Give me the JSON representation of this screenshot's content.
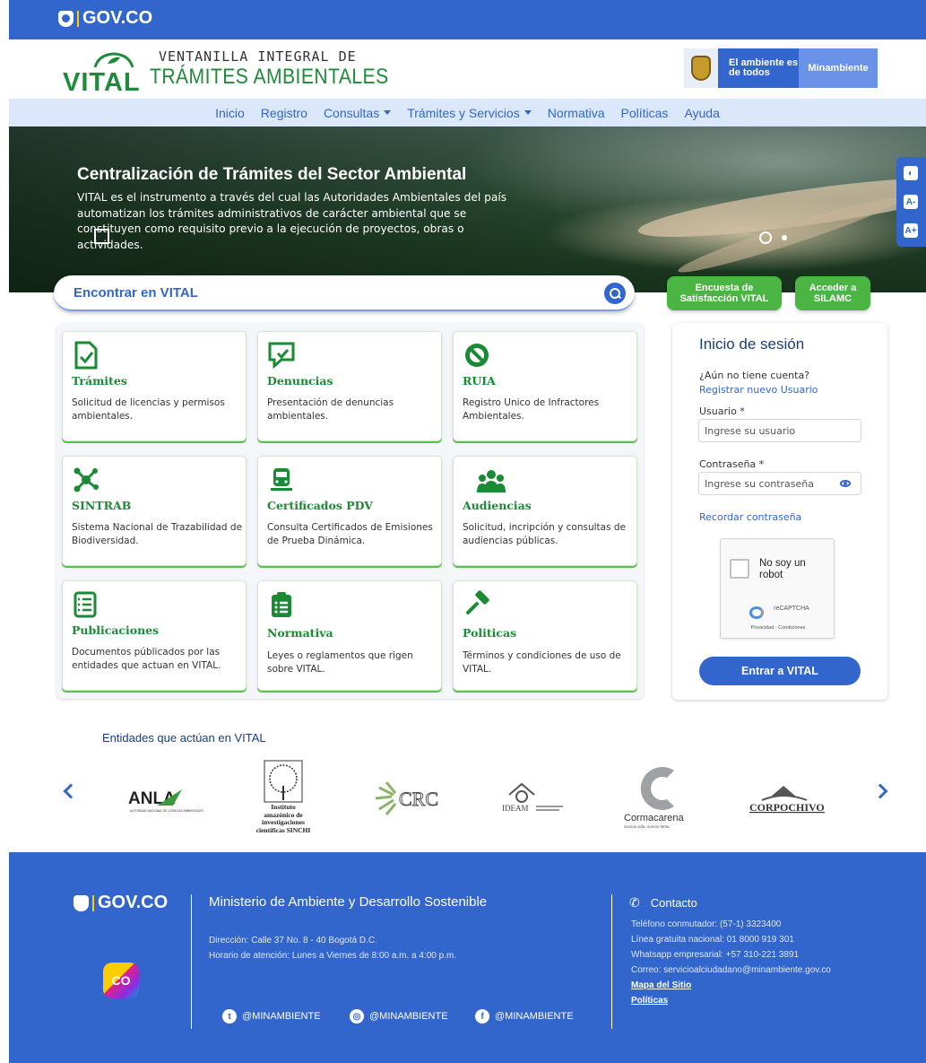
{
  "gov_bar": {
    "logo": "GOV.CO"
  },
  "header": {
    "vital_word": "VITAL",
    "title_line1": "VENTANILLA INTEGRAL DE",
    "title_line2": "TRÁMITES AMBIENTALES",
    "partner_amb": "El ambiente es de todos",
    "partner_min": "Minambiente"
  },
  "nav": {
    "items": [
      {
        "label": "Inicio"
      },
      {
        "label": "Registro"
      },
      {
        "label": "Consultas"
      },
      {
        "label": "Trámites y Servicios"
      },
      {
        "label": "Normativa"
      },
      {
        "label": "Políticas"
      },
      {
        "label": "Ayuda"
      }
    ]
  },
  "hero": {
    "title": "Centralización de Trámites del Sector Ambiental",
    "text": "VITAL es el instrumento a través del cual las Autoridades Ambientales del país automatizan los trámites administrativos de carácter ambiental que se constituyen como requisito previo a la ejecución de proyectos, obras o actividades.",
    "slides_total": 2,
    "slide_active": 1
  },
  "accessibility": {
    "contrast_icon": "contrast-icon",
    "decrease": "A-",
    "increase": "A+"
  },
  "search": {
    "label": "Encontrar en VITAL"
  },
  "buttons": {
    "survey": "Encuesta de Satisfacción VITAL",
    "silamc": "Acceder a SILAMC"
  },
  "cards": [
    {
      "title": "Trámites",
      "desc": "Solicitud de licencias y permisos ambientales.",
      "icon": "document-check-icon"
    },
    {
      "title": "Denuncias",
      "desc": "Presentación de denuncias ambientales.",
      "icon": "chat-check-icon"
    },
    {
      "title": "RUIA",
      "desc": "Registro Unico de Infractores Ambientales.",
      "icon": "prohibited-icon"
    },
    {
      "title": "SINTRAB",
      "desc": "Sistema Nacional de Trazabilidad de Biodiversidad.",
      "icon": "network-icon"
    },
    {
      "title": "Certificados PDV",
      "desc": "Consulta Certificados de Emisiones de Prueba Dinámica.",
      "icon": "bus-icon"
    },
    {
      "title": "Audiencias",
      "desc": "Solicitud, incripción y consultas de audiencias públicas.",
      "icon": "people-icon"
    },
    {
      "title": "Publicaciones",
      "desc": "Documentos públicados por las entidades que actuan en VITAL.",
      "icon": "list-icon"
    },
    {
      "title": "Normativa",
      "desc": "Leyes o reglamentos que rigen sobre VITAL.",
      "icon": "clipboard-icon"
    },
    {
      "title": "Politicas",
      "desc": "Términos y condiciones de uso de VITAL.",
      "icon": "gavel-icon"
    }
  ],
  "login": {
    "title": "Inicio de sesión",
    "no_account": "¿Aún no tiene cuenta?",
    "register_link": "Registrar nuevo Usuario",
    "user_label": "Usuario *",
    "user_placeholder": "Ingrese su usuario",
    "pass_label": "Contraseña *",
    "pass_placeholder": "Ingrese su contraseña",
    "remember_link": "Recordar contraseña",
    "captcha_label": "No soy un robot",
    "captcha_brand": "reCAPTCHA",
    "captcha_privacy": "Privacidad - Condiciones",
    "submit": "Entrar a VITAL"
  },
  "entities": {
    "title": "Entidades que actúan en VITAL",
    "logos": [
      {
        "name": "ANLA",
        "subtitle": "AUTORIDAD NACIONAL DE LICENCIAS AMBIENTALES"
      },
      {
        "name": "Instituto amazónico de investigaciones científicas SINCHI"
      },
      {
        "name": "CRC"
      },
      {
        "name": "IDEAM"
      },
      {
        "name": "Cormacarena",
        "subtitle": "Somos vida, somos Meta"
      },
      {
        "name": "CORPOCHIVOR"
      }
    ]
  },
  "footer": {
    "logo": "GOV.CO",
    "co_badge": "CO",
    "ministry": "Ministerio de Ambiente y Desarrollo Sostenible",
    "address": "Dirección: Calle 37 No. 8 - 40 Bogotá D.C.",
    "hours": "Horario de atención: Lunes a Viernes de 8:00 a.m. a 4:00 p.m.",
    "social": [
      {
        "network": "twitter",
        "handle": "@MINAMBIENTE"
      },
      {
        "network": "instagram",
        "handle": "@MINAMBIENTE"
      },
      {
        "network": "facebook",
        "handle": "@MINAMBIENTE"
      }
    ],
    "contact_title": "Contacto",
    "phone": "Teléfono conmutador: (57-1) 3323400",
    "toll_free": "Línea gratuita nacional: 01 8000 919 301",
    "whatsapp": "Whatsapp empresarial: +57 310-221 3891",
    "email": "Correo: servicioalciudadano@minambiente.gov.co",
    "sitemap": "Mapa del Sitio",
    "policies": "Políticas"
  },
  "colors": {
    "primary": "#3366cc",
    "green": "#1a8a34",
    "button_green": "#4bb543"
  }
}
